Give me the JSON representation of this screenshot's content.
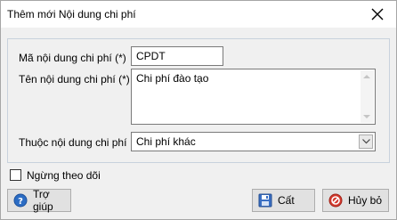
{
  "window": {
    "title": "Thêm mới Nội dung chi phí"
  },
  "form": {
    "code_label": "Mã nội dung chi phí (*)",
    "code_value": "CPDT",
    "name_label": "Tên nội dung chi phí (*)",
    "name_value": "Chi phí đào tạo",
    "group_label": "Thuộc nội dung chi phí",
    "group_value": "Chi phí khác"
  },
  "options": {
    "inactive_label": "Ngừng theo dõi",
    "inactive_checked": false
  },
  "buttons": {
    "help": "Trợ giúp",
    "save": "Cất",
    "cancel": "Hủy bỏ"
  },
  "colors": {
    "help_icon": "#2b6cc4",
    "save_icon": "#3a6fc4",
    "cancel_icon": "#d43a2f"
  }
}
